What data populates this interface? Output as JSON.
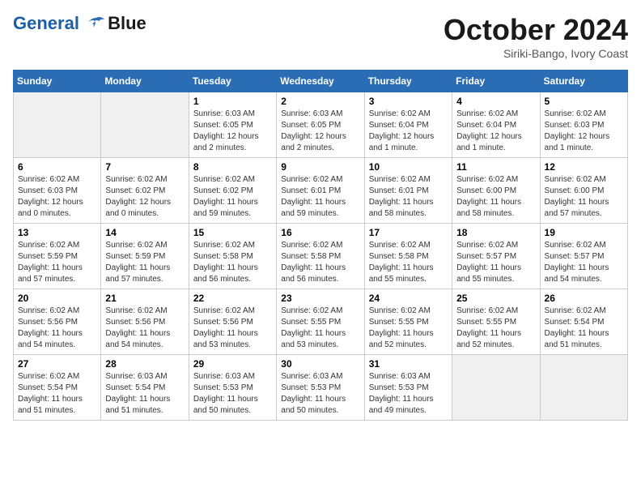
{
  "logo": {
    "line1": "General",
    "line2": "Blue"
  },
  "title": "October 2024",
  "subtitle": "Siriki-Bango, Ivory Coast",
  "headers": [
    "Sunday",
    "Monday",
    "Tuesday",
    "Wednesday",
    "Thursday",
    "Friday",
    "Saturday"
  ],
  "weeks": [
    [
      {
        "day": "",
        "info": ""
      },
      {
        "day": "",
        "info": ""
      },
      {
        "day": "1",
        "info": "Sunrise: 6:03 AM\nSunset: 6:05 PM\nDaylight: 12 hours\nand 2 minutes."
      },
      {
        "day": "2",
        "info": "Sunrise: 6:03 AM\nSunset: 6:05 PM\nDaylight: 12 hours\nand 2 minutes."
      },
      {
        "day": "3",
        "info": "Sunrise: 6:02 AM\nSunset: 6:04 PM\nDaylight: 12 hours\nand 1 minute."
      },
      {
        "day": "4",
        "info": "Sunrise: 6:02 AM\nSunset: 6:04 PM\nDaylight: 12 hours\nand 1 minute."
      },
      {
        "day": "5",
        "info": "Sunrise: 6:02 AM\nSunset: 6:03 PM\nDaylight: 12 hours\nand 1 minute."
      }
    ],
    [
      {
        "day": "6",
        "info": "Sunrise: 6:02 AM\nSunset: 6:03 PM\nDaylight: 12 hours\nand 0 minutes."
      },
      {
        "day": "7",
        "info": "Sunrise: 6:02 AM\nSunset: 6:02 PM\nDaylight: 12 hours\nand 0 minutes."
      },
      {
        "day": "8",
        "info": "Sunrise: 6:02 AM\nSunset: 6:02 PM\nDaylight: 11 hours\nand 59 minutes."
      },
      {
        "day": "9",
        "info": "Sunrise: 6:02 AM\nSunset: 6:01 PM\nDaylight: 11 hours\nand 59 minutes."
      },
      {
        "day": "10",
        "info": "Sunrise: 6:02 AM\nSunset: 6:01 PM\nDaylight: 11 hours\nand 58 minutes."
      },
      {
        "day": "11",
        "info": "Sunrise: 6:02 AM\nSunset: 6:00 PM\nDaylight: 11 hours\nand 58 minutes."
      },
      {
        "day": "12",
        "info": "Sunrise: 6:02 AM\nSunset: 6:00 PM\nDaylight: 11 hours\nand 57 minutes."
      }
    ],
    [
      {
        "day": "13",
        "info": "Sunrise: 6:02 AM\nSunset: 5:59 PM\nDaylight: 11 hours\nand 57 minutes."
      },
      {
        "day": "14",
        "info": "Sunrise: 6:02 AM\nSunset: 5:59 PM\nDaylight: 11 hours\nand 57 minutes."
      },
      {
        "day": "15",
        "info": "Sunrise: 6:02 AM\nSunset: 5:58 PM\nDaylight: 11 hours\nand 56 minutes."
      },
      {
        "day": "16",
        "info": "Sunrise: 6:02 AM\nSunset: 5:58 PM\nDaylight: 11 hours\nand 56 minutes."
      },
      {
        "day": "17",
        "info": "Sunrise: 6:02 AM\nSunset: 5:58 PM\nDaylight: 11 hours\nand 55 minutes."
      },
      {
        "day": "18",
        "info": "Sunrise: 6:02 AM\nSunset: 5:57 PM\nDaylight: 11 hours\nand 55 minutes."
      },
      {
        "day": "19",
        "info": "Sunrise: 6:02 AM\nSunset: 5:57 PM\nDaylight: 11 hours\nand 54 minutes."
      }
    ],
    [
      {
        "day": "20",
        "info": "Sunrise: 6:02 AM\nSunset: 5:56 PM\nDaylight: 11 hours\nand 54 minutes."
      },
      {
        "day": "21",
        "info": "Sunrise: 6:02 AM\nSunset: 5:56 PM\nDaylight: 11 hours\nand 54 minutes."
      },
      {
        "day": "22",
        "info": "Sunrise: 6:02 AM\nSunset: 5:56 PM\nDaylight: 11 hours\nand 53 minutes."
      },
      {
        "day": "23",
        "info": "Sunrise: 6:02 AM\nSunset: 5:55 PM\nDaylight: 11 hours\nand 53 minutes."
      },
      {
        "day": "24",
        "info": "Sunrise: 6:02 AM\nSunset: 5:55 PM\nDaylight: 11 hours\nand 52 minutes."
      },
      {
        "day": "25",
        "info": "Sunrise: 6:02 AM\nSunset: 5:55 PM\nDaylight: 11 hours\nand 52 minutes."
      },
      {
        "day": "26",
        "info": "Sunrise: 6:02 AM\nSunset: 5:54 PM\nDaylight: 11 hours\nand 51 minutes."
      }
    ],
    [
      {
        "day": "27",
        "info": "Sunrise: 6:02 AM\nSunset: 5:54 PM\nDaylight: 11 hours\nand 51 minutes."
      },
      {
        "day": "28",
        "info": "Sunrise: 6:03 AM\nSunset: 5:54 PM\nDaylight: 11 hours\nand 51 minutes."
      },
      {
        "day": "29",
        "info": "Sunrise: 6:03 AM\nSunset: 5:53 PM\nDaylight: 11 hours\nand 50 minutes."
      },
      {
        "day": "30",
        "info": "Sunrise: 6:03 AM\nSunset: 5:53 PM\nDaylight: 11 hours\nand 50 minutes."
      },
      {
        "day": "31",
        "info": "Sunrise: 6:03 AM\nSunset: 5:53 PM\nDaylight: 11 hours\nand 49 minutes."
      },
      {
        "day": "",
        "info": ""
      },
      {
        "day": "",
        "info": ""
      }
    ]
  ]
}
